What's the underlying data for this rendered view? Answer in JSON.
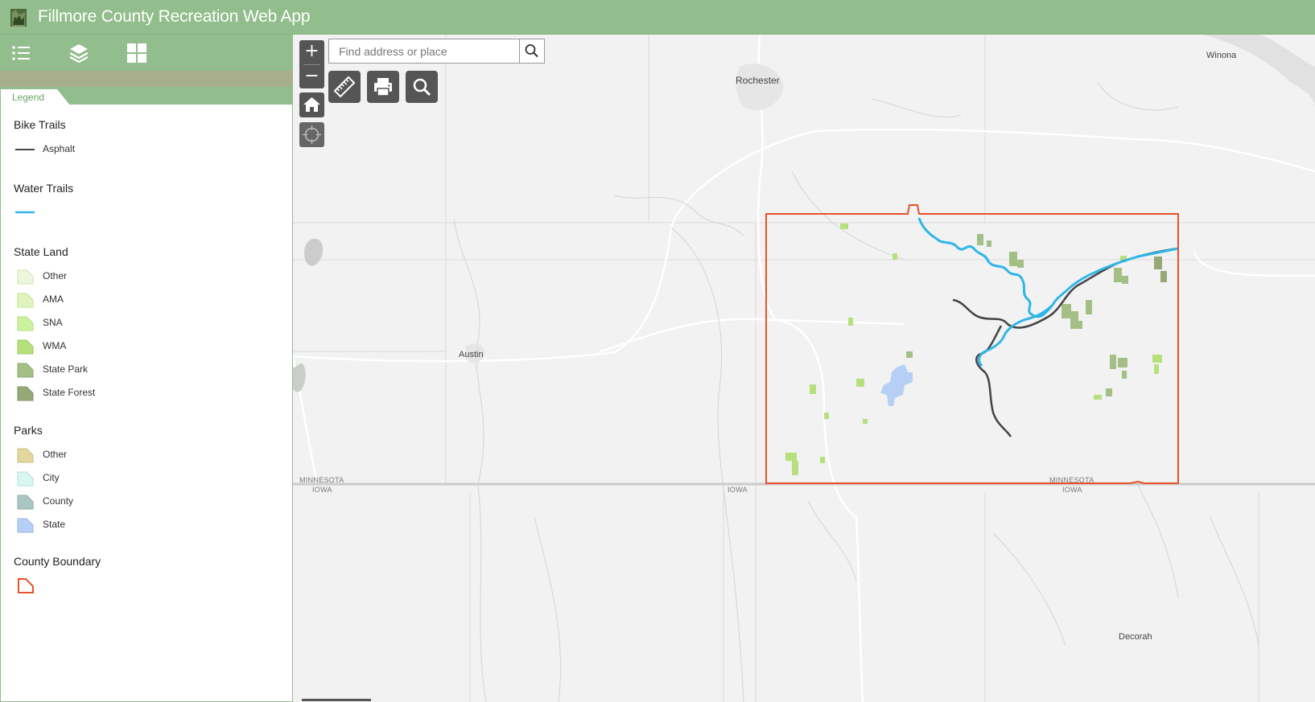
{
  "header": {
    "title": "Fillmore County Recreation Web App",
    "logo_icon": "minnesota-state-icon"
  },
  "panel_toolbar": {
    "items": [
      {
        "icon": "list-icon",
        "name": "legend-toolbar-button"
      },
      {
        "icon": "layers-icon",
        "name": "layers-toolbar-button"
      },
      {
        "icon": "grid-icon",
        "name": "basemap-gallery-toolbar-button"
      }
    ]
  },
  "legend": {
    "tab_label": "Legend",
    "sections": {
      "bike_trails": {
        "title": "Bike Trails",
        "items": [
          {
            "label": "Asphalt"
          }
        ]
      },
      "water_trails": {
        "title": "Water Trails"
      },
      "state_land": {
        "title": "State Land",
        "items": [
          {
            "label": "Other"
          },
          {
            "label": "AMA"
          },
          {
            "label": "SNA"
          },
          {
            "label": "WMA"
          },
          {
            "label": "State Park"
          },
          {
            "label": "State Forest"
          }
        ]
      },
      "parks": {
        "title": "Parks",
        "items": [
          {
            "label": "Other"
          },
          {
            "label": "City"
          },
          {
            "label": "County"
          },
          {
            "label": "State"
          }
        ]
      },
      "county_boundary": {
        "title": "County Boundary"
      }
    }
  },
  "map": {
    "search": {
      "placeholder": "Find address or place"
    },
    "zoom_in": "+",
    "zoom_out": "−",
    "labels": {
      "rochester": "Rochester",
      "winona": "Winona",
      "austin": "Austin",
      "decorah": "Decorah",
      "mn_left": "MINNESOTA",
      "ia_left": "IOWA",
      "ia_mid": "IOWA",
      "mn_right": "MINNESOTA",
      "ia_right": "IOWA"
    }
  },
  "colors": {
    "header": "#92bd8c",
    "county_boundary": "#e8512b",
    "water_trail": "#2fb6e8",
    "bike_trail": "#444444",
    "state_land_other": "#eef7d9",
    "state_land_ama": "#dff5bd",
    "state_land_sna": "#ccf29d",
    "state_land_wma": "#b6e07e",
    "state_land_park": "#a4bf86",
    "state_land_forest": "#97a877",
    "parks_other": "#e4d79c",
    "parks_city": "#d8f7ef",
    "parks_county": "#a9c6c3",
    "parks_state": "#b6cff5"
  }
}
